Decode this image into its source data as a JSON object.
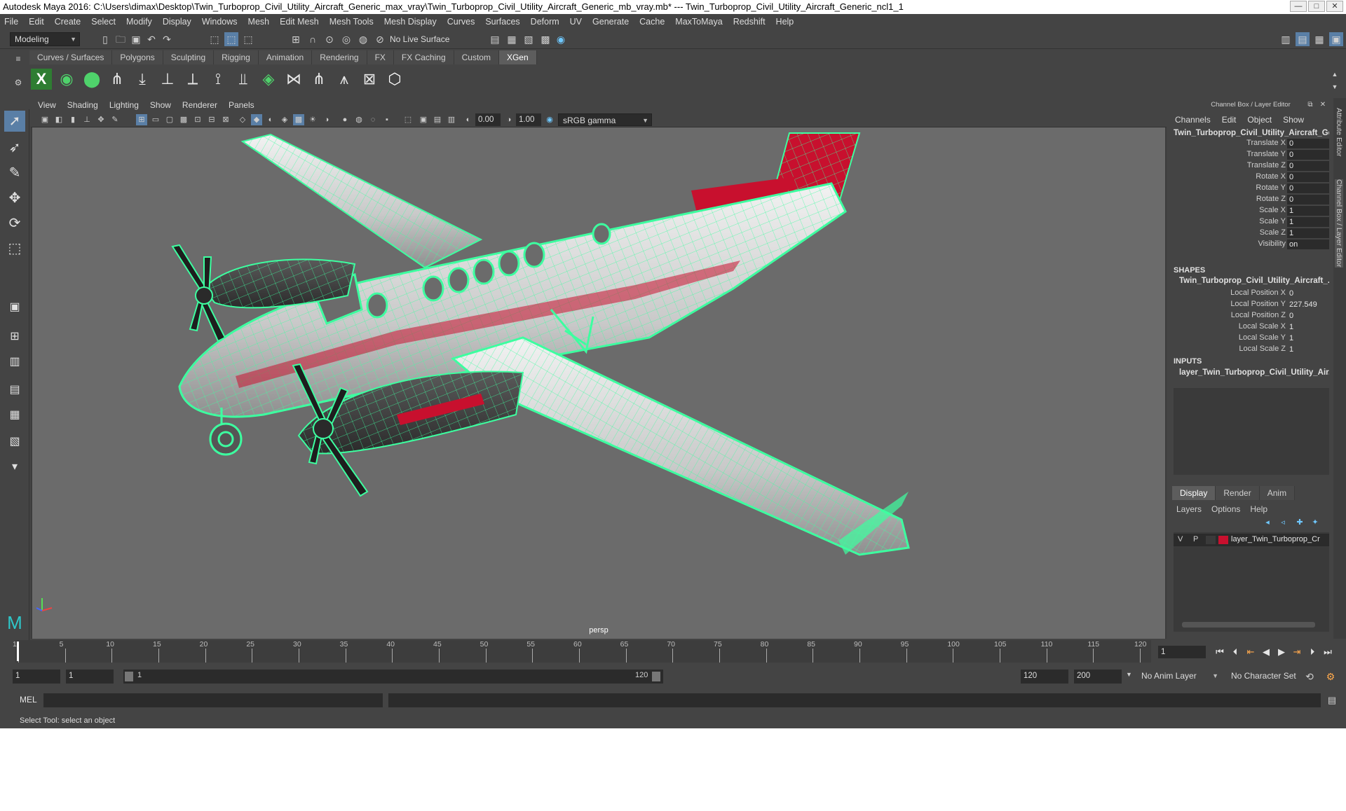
{
  "title": {
    "text": "Autodesk Maya 2016: C:\\Users\\dimax\\Desktop\\Twin_Turboprop_Civil_Utility_Aircraft_Generic_max_vray\\Twin_Turboprop_Civil_Utility_Aircraft_Generic_mb_vray.mb*   ---   Twin_Turboprop_Civil_Utility_Aircraft_Generic_ncl1_1",
    "minimize": "—",
    "maximize": "□",
    "close": "✕"
  },
  "menu": [
    "File",
    "Edit",
    "Create",
    "Select",
    "Modify",
    "Display",
    "Windows",
    "Mesh",
    "Edit Mesh",
    "Mesh Tools",
    "Mesh Display",
    "Curves",
    "Surfaces",
    "Deform",
    "UV",
    "Generate",
    "Cache",
    "MaxToMaya",
    "Redshift",
    "Help"
  ],
  "status": {
    "mode": "Modeling",
    "live_surface": "No Live Surface"
  },
  "shelf_tabs": [
    "Curves / Surfaces",
    "Polygons",
    "Sculpting",
    "Rigging",
    "Animation",
    "Rendering",
    "FX",
    "FX Caching",
    "Custom",
    "XGen"
  ],
  "active_shelf_tab": "XGen",
  "viewport": {
    "menu": [
      "View",
      "Shading",
      "Lighting",
      "Show",
      "Renderer",
      "Panels"
    ],
    "exposure": "0.00",
    "gamma": "1.00",
    "color_space": "sRGB gamma",
    "camera": "persp"
  },
  "channel_box": {
    "title": "Channel Box / Layer Editor",
    "menu": [
      "Channels",
      "Edit",
      "Object",
      "Show"
    ],
    "object_name": "Twin_Turboprop_Civil_Utility_Aircraft_Ge...",
    "transforms": [
      {
        "label": "Translate X",
        "value": "0"
      },
      {
        "label": "Translate Y",
        "value": "0"
      },
      {
        "label": "Translate Z",
        "value": "0"
      },
      {
        "label": "Rotate X",
        "value": "0"
      },
      {
        "label": "Rotate Y",
        "value": "0"
      },
      {
        "label": "Rotate Z",
        "value": "0"
      },
      {
        "label": "Scale X",
        "value": "1"
      },
      {
        "label": "Scale Y",
        "value": "1"
      },
      {
        "label": "Scale Z",
        "value": "1"
      },
      {
        "label": "Visibility",
        "value": "on"
      }
    ],
    "shapes_header": "SHAPES",
    "shape_name": "Twin_Turboprop_Civil_Utility_Aircraft_...",
    "shape_attrs": [
      {
        "label": "Local Position X",
        "value": "0"
      },
      {
        "label": "Local Position Y",
        "value": "227.549"
      },
      {
        "label": "Local Position Z",
        "value": "0"
      },
      {
        "label": "Local Scale X",
        "value": "1"
      },
      {
        "label": "Local Scale Y",
        "value": "1"
      },
      {
        "label": "Local Scale Z",
        "value": "1"
      }
    ],
    "inputs_header": "INPUTS",
    "input_name": "layer_Twin_Turboprop_Civil_Utility_Air..."
  },
  "layer_editor": {
    "tabs": [
      "Display",
      "Render",
      "Anim"
    ],
    "active_tab": "Display",
    "menu": [
      "Layers",
      "Options",
      "Help"
    ],
    "layer": {
      "v": "V",
      "p": "P",
      "name": "layer_Twin_Turboprop_Cr",
      "color": "#c8102e"
    }
  },
  "side_tabs": [
    "Attribute Editor",
    "Channel Box / Layer Editor"
  ],
  "timeline": {
    "ticks": [
      "1",
      "5",
      "10",
      "15",
      "20",
      "25",
      "30",
      "35",
      "40",
      "45",
      "50",
      "55",
      "60",
      "65",
      "70",
      "75",
      "80",
      "85",
      "90",
      "95",
      "100",
      "105",
      "110",
      "115",
      "120"
    ],
    "current_frame": "1"
  },
  "range": {
    "start": "1",
    "playback_start": "1",
    "slider_start": "1",
    "slider_end": "120",
    "playback_end": "120",
    "end": "200",
    "anim_layer": "No Anim Layer",
    "character_set": "No Character Set"
  },
  "mel": {
    "label": "MEL"
  },
  "help_line": "Select Tool: select an object",
  "colors": {
    "wire": "#3dffa0",
    "accent": "#c8102e",
    "ui_bg": "#444444",
    "viewport_bg": "#6b6b6b"
  }
}
